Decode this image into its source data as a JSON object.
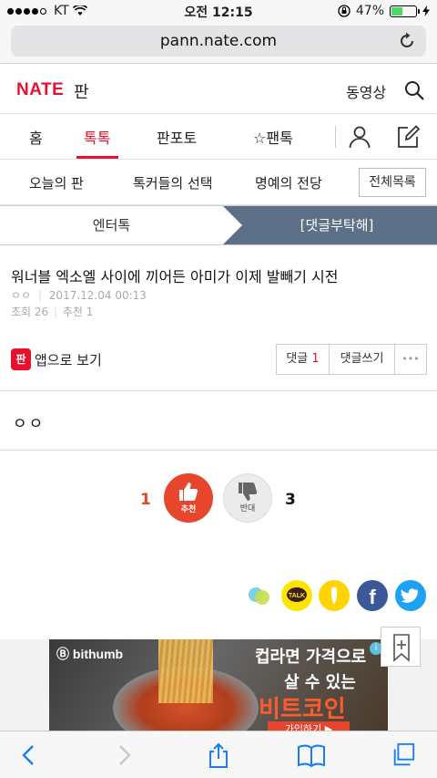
{
  "status": {
    "carrier": "KT",
    "time": "오전 12:15",
    "battery": "47%",
    "battery_level": 0.47
  },
  "browser": {
    "url": "pann.nate.com"
  },
  "header": {
    "logo": "NATE",
    "logo_sub": "판",
    "video_link": "동영상"
  },
  "main_tabs": [
    {
      "label": "홈"
    },
    {
      "label": "톡톡"
    },
    {
      "label": "판포토"
    },
    {
      "label": "☆팬톡"
    }
  ],
  "sub_nav": {
    "items": [
      "오늘의 판",
      "톡커들의 선택",
      "명예의 전당"
    ],
    "all_button": "전체목록"
  },
  "breadcrumb": {
    "left": "엔터톡",
    "right": "[댓글부탁해]"
  },
  "post": {
    "title": "워너블 엑소엘 사이에 끼어든 아미가 이제 발빼기 시전",
    "author": "ㅇㅇ",
    "date": "2017.12.04 00:13",
    "views": "조회 26",
    "recommends": "추천 1",
    "app_icon": "판",
    "app_view": "앱으로 보기",
    "comment_label": "댓글",
    "comment_count": "1",
    "write_comment": "댓글쓰기",
    "more": "•••",
    "body": "ㅇㅇ"
  },
  "votes": {
    "up_count": "1",
    "up_label": "추천",
    "down_count": "3",
    "down_label": "반대"
  },
  "ad": {
    "brand": "bithumb",
    "line1": "컵라면 가격으로",
    "line2": "살 수 있는",
    "line3": "비트코인",
    "cta": "가입하기 ▶",
    "info": "i"
  },
  "colors": {
    "accent": "#e8112d",
    "crumb_active": "#5c7087",
    "vote_up": "#e8452d"
  }
}
